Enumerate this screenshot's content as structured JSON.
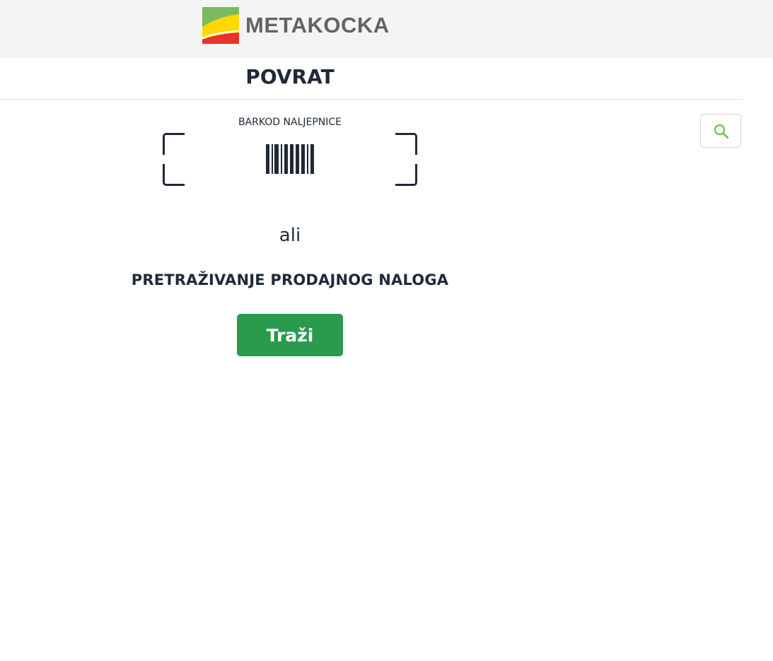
{
  "header": {
    "brand_name": "METAKOCKA",
    "logo_colors": {
      "green": "#7cba5e",
      "yellow": "#ffd800",
      "red": "#e8322a"
    }
  },
  "page": {
    "title": "POVRAT"
  },
  "scan": {
    "label": "BARKOD NALJEPNICE",
    "icon": "barcode-icon"
  },
  "separator": {
    "or_text": "ali"
  },
  "order_search": {
    "label": "PRETRAŽIVANJE PRODAJNOG NALOGA",
    "button_label": "Traži",
    "button_color": "#2a9a4d"
  },
  "toolbar": {
    "search_icon": "search-icon",
    "search_icon_color": "#6cbf4b"
  }
}
